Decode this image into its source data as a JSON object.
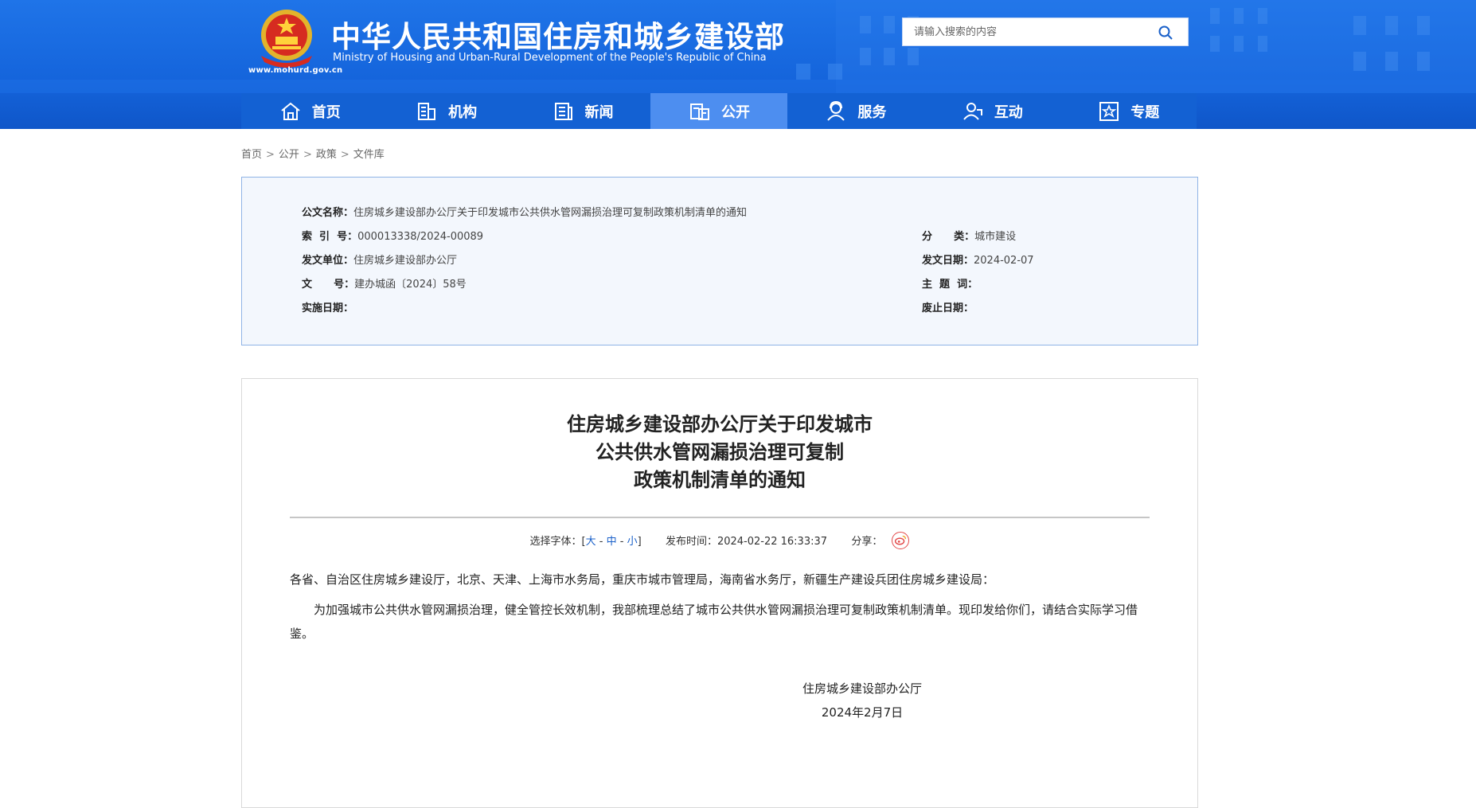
{
  "header": {
    "site_title": "中华人民共和国住房和城乡建设部",
    "site_subtitle": "Ministry of Housing and Urban-Rural Development of the People's Republic of China",
    "site_url": "www.mohurd.gov.cn",
    "search": {
      "placeholder": "请输入搜索的内容"
    }
  },
  "nav": [
    {
      "label": "首页",
      "icon": "home-icon"
    },
    {
      "label": "机构",
      "icon": "building-icon"
    },
    {
      "label": "新闻",
      "icon": "news-icon"
    },
    {
      "label": "公开",
      "icon": "document-icon",
      "active": true
    },
    {
      "label": "服务",
      "icon": "service-icon"
    },
    {
      "label": "互动",
      "icon": "interaction-icon"
    },
    {
      "label": "专题",
      "icon": "star-icon"
    }
  ],
  "breadcrumb": [
    "首页",
    "公开",
    "政策",
    "文件库"
  ],
  "meta": {
    "name_k": "公文名称：",
    "name_v": "住房城乡建设部办公厅关于印发城市公共供水管网漏损治理可复制政策机制清单的通知",
    "index_k": "索  引  号：",
    "index_v": "000013338/2024-00089",
    "cat_k": "分      类：",
    "cat_v": "城市建设",
    "issuer_k": "发文单位：",
    "issuer_v": "住房城乡建设部办公厅",
    "date_k": "发文日期：",
    "date_v": "2024-02-07",
    "doc_no_k": "文      号：",
    "doc_no_v": "建办城函〔2024〕58号",
    "topic_k": "主  题  词：",
    "topic_v": "",
    "impl_k": "实施日期：",
    "impl_v": "",
    "expire_k": "废止日期：",
    "expire_v": ""
  },
  "article": {
    "title_lines": [
      "住房城乡建设部办公厅关于印发城市",
      "公共供水管网漏损治理可复制",
      "政策机制清单的通知"
    ],
    "font_label": "选择字体：[",
    "font_large": "大",
    "font_medium": "中",
    "font_small": "小",
    "font_sep": " - ",
    "font_end": "]",
    "publish_label": "发布时间：",
    "publish_time": "2024-02-22 16:33:37",
    "share_label": "分享：",
    "salutation": "各省、自治区住房城乡建设厅，北京、天津、上海市水务局，重庆市城市管理局，海南省水务厅，新疆生产建设兵团住房城乡建设局：",
    "paragraph": "为加强城市公共供水管网漏损治理，健全管控长效机制，我部梳理总结了城市公共供水管网漏损治理可复制政策机制清单。现印发给你们，请结合实际学习借鉴。",
    "signer": "住房城乡建设部办公厅",
    "sign_date": "2024年2月7日"
  }
}
